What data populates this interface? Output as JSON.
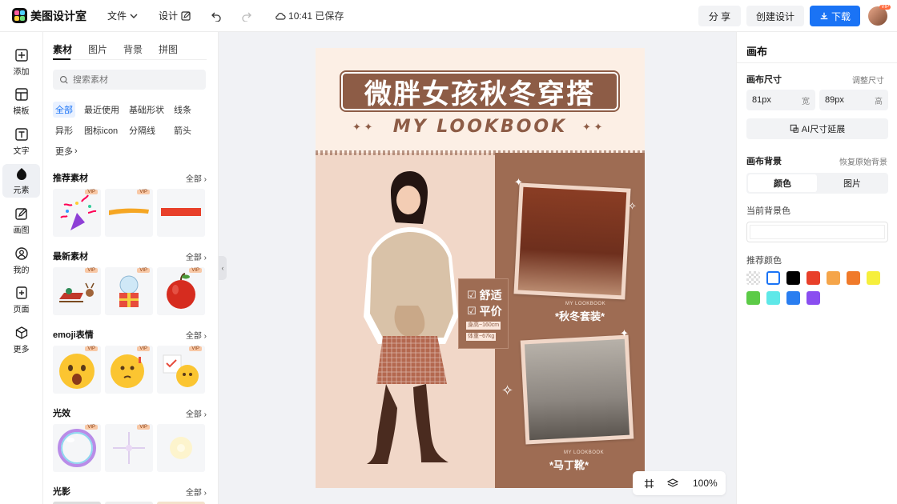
{
  "app": {
    "name": "美图设计室"
  },
  "menu": {
    "file": "文件",
    "design": "设计",
    "saved_time": "10:41 已保存"
  },
  "toolbar": {
    "share": "分 享",
    "create": "创建设计",
    "download": "下载",
    "avatar_vip": "VIP"
  },
  "rail": [
    {
      "icon": "plus-square-icon",
      "label": "添加"
    },
    {
      "icon": "template-icon",
      "label": "模板"
    },
    {
      "icon": "text-icon",
      "label": "文字"
    },
    {
      "icon": "shapes-icon",
      "label": "元素"
    },
    {
      "icon": "draw-icon",
      "label": "画图"
    },
    {
      "icon": "user-icon",
      "label": "我的"
    },
    {
      "icon": "add-page-icon",
      "label": "页面"
    },
    {
      "icon": "cube-icon",
      "label": "更多"
    }
  ],
  "panel": {
    "tabs": [
      "素材",
      "图片",
      "背景",
      "拼图"
    ],
    "search_placeholder": "搜索素材",
    "chips": [
      "全部",
      "最近使用",
      "基础形状",
      "线条",
      "异形",
      "图标icon",
      "分隔线",
      "箭头",
      "更多"
    ],
    "all_label": "全部",
    "vip": "VIP",
    "sections": [
      {
        "title": "推荐素材"
      },
      {
        "title": "最新素材"
      },
      {
        "title": "emoji表情"
      },
      {
        "title": "光效"
      },
      {
        "title": "光影"
      }
    ]
  },
  "poster": {
    "title": "微胖女孩秋冬穿搭",
    "subtitle": "MY LOOKBOOK",
    "tag1": "舒适",
    "tag2": "平价",
    "height": "身高~160cm",
    "weight": "体重~67kg",
    "cap_small_1": "MY LOOKBOOK",
    "caption_1": "*秋冬套装*",
    "cap_small_2": "MY LOOKBOOK",
    "caption_2": "*马丁靴*"
  },
  "zoom": {
    "level": "100%"
  },
  "right": {
    "title": "画布",
    "size_label": "画布尺寸",
    "adjust": "调整尺寸",
    "width_value": "81px",
    "width_unit": "宽",
    "height_value": "89px",
    "height_unit": "高",
    "ai_extend": "AI尺寸延展",
    "bg_label": "画布背景",
    "restore_bg": "恢复原始背景",
    "seg_color": "颜色",
    "seg_image": "图片",
    "current_color_label": "当前背景色",
    "recommend_label": "推荐颜色",
    "swatches": [
      "transparent",
      "#ffffff",
      "#000000",
      "#e8402a",
      "#f5a54a",
      "#f07a2a",
      "#f6ef3c",
      "#5ccb47",
      "#5ee8e8",
      "#2a7ef0",
      "#8a4ef0"
    ]
  }
}
